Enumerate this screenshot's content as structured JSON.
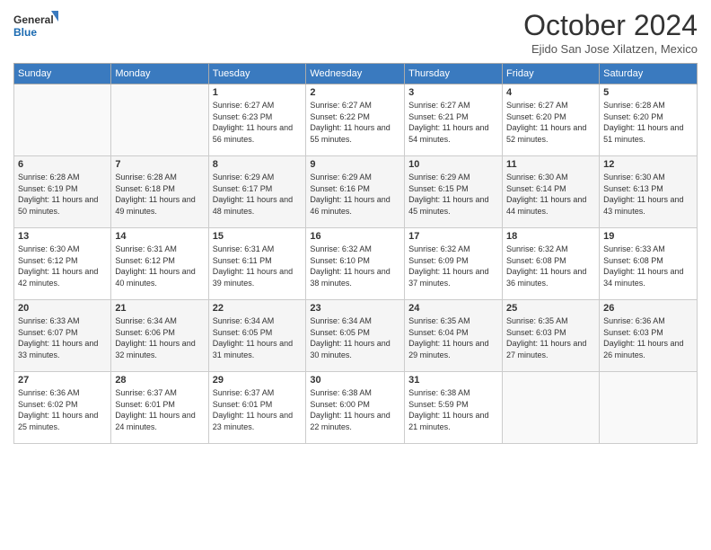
{
  "header": {
    "logo_line1": "General",
    "logo_line2": "Blue",
    "month_title": "October 2024",
    "location": "Ejido San Jose Xilatzen, Mexico"
  },
  "days_of_week": [
    "Sunday",
    "Monday",
    "Tuesday",
    "Wednesday",
    "Thursday",
    "Friday",
    "Saturday"
  ],
  "weeks": [
    [
      {
        "day": "",
        "info": ""
      },
      {
        "day": "",
        "info": ""
      },
      {
        "day": "1",
        "info": "Sunrise: 6:27 AM\nSunset: 6:23 PM\nDaylight: 11 hours and 56 minutes."
      },
      {
        "day": "2",
        "info": "Sunrise: 6:27 AM\nSunset: 6:22 PM\nDaylight: 11 hours and 55 minutes."
      },
      {
        "day": "3",
        "info": "Sunrise: 6:27 AM\nSunset: 6:21 PM\nDaylight: 11 hours and 54 minutes."
      },
      {
        "day": "4",
        "info": "Sunrise: 6:27 AM\nSunset: 6:20 PM\nDaylight: 11 hours and 52 minutes."
      },
      {
        "day": "5",
        "info": "Sunrise: 6:28 AM\nSunset: 6:20 PM\nDaylight: 11 hours and 51 minutes."
      }
    ],
    [
      {
        "day": "6",
        "info": "Sunrise: 6:28 AM\nSunset: 6:19 PM\nDaylight: 11 hours and 50 minutes."
      },
      {
        "day": "7",
        "info": "Sunrise: 6:28 AM\nSunset: 6:18 PM\nDaylight: 11 hours and 49 minutes."
      },
      {
        "day": "8",
        "info": "Sunrise: 6:29 AM\nSunset: 6:17 PM\nDaylight: 11 hours and 48 minutes."
      },
      {
        "day": "9",
        "info": "Sunrise: 6:29 AM\nSunset: 6:16 PM\nDaylight: 11 hours and 46 minutes."
      },
      {
        "day": "10",
        "info": "Sunrise: 6:29 AM\nSunset: 6:15 PM\nDaylight: 11 hours and 45 minutes."
      },
      {
        "day": "11",
        "info": "Sunrise: 6:30 AM\nSunset: 6:14 PM\nDaylight: 11 hours and 44 minutes."
      },
      {
        "day": "12",
        "info": "Sunrise: 6:30 AM\nSunset: 6:13 PM\nDaylight: 11 hours and 43 minutes."
      }
    ],
    [
      {
        "day": "13",
        "info": "Sunrise: 6:30 AM\nSunset: 6:12 PM\nDaylight: 11 hours and 42 minutes."
      },
      {
        "day": "14",
        "info": "Sunrise: 6:31 AM\nSunset: 6:12 PM\nDaylight: 11 hours and 40 minutes."
      },
      {
        "day": "15",
        "info": "Sunrise: 6:31 AM\nSunset: 6:11 PM\nDaylight: 11 hours and 39 minutes."
      },
      {
        "day": "16",
        "info": "Sunrise: 6:32 AM\nSunset: 6:10 PM\nDaylight: 11 hours and 38 minutes."
      },
      {
        "day": "17",
        "info": "Sunrise: 6:32 AM\nSunset: 6:09 PM\nDaylight: 11 hours and 37 minutes."
      },
      {
        "day": "18",
        "info": "Sunrise: 6:32 AM\nSunset: 6:08 PM\nDaylight: 11 hours and 36 minutes."
      },
      {
        "day": "19",
        "info": "Sunrise: 6:33 AM\nSunset: 6:08 PM\nDaylight: 11 hours and 34 minutes."
      }
    ],
    [
      {
        "day": "20",
        "info": "Sunrise: 6:33 AM\nSunset: 6:07 PM\nDaylight: 11 hours and 33 minutes."
      },
      {
        "day": "21",
        "info": "Sunrise: 6:34 AM\nSunset: 6:06 PM\nDaylight: 11 hours and 32 minutes."
      },
      {
        "day": "22",
        "info": "Sunrise: 6:34 AM\nSunset: 6:05 PM\nDaylight: 11 hours and 31 minutes."
      },
      {
        "day": "23",
        "info": "Sunrise: 6:34 AM\nSunset: 6:05 PM\nDaylight: 11 hours and 30 minutes."
      },
      {
        "day": "24",
        "info": "Sunrise: 6:35 AM\nSunset: 6:04 PM\nDaylight: 11 hours and 29 minutes."
      },
      {
        "day": "25",
        "info": "Sunrise: 6:35 AM\nSunset: 6:03 PM\nDaylight: 11 hours and 27 minutes."
      },
      {
        "day": "26",
        "info": "Sunrise: 6:36 AM\nSunset: 6:03 PM\nDaylight: 11 hours and 26 minutes."
      }
    ],
    [
      {
        "day": "27",
        "info": "Sunrise: 6:36 AM\nSunset: 6:02 PM\nDaylight: 11 hours and 25 minutes."
      },
      {
        "day": "28",
        "info": "Sunrise: 6:37 AM\nSunset: 6:01 PM\nDaylight: 11 hours and 24 minutes."
      },
      {
        "day": "29",
        "info": "Sunrise: 6:37 AM\nSunset: 6:01 PM\nDaylight: 11 hours and 23 minutes."
      },
      {
        "day": "30",
        "info": "Sunrise: 6:38 AM\nSunset: 6:00 PM\nDaylight: 11 hours and 22 minutes."
      },
      {
        "day": "31",
        "info": "Sunrise: 6:38 AM\nSunset: 5:59 PM\nDaylight: 11 hours and 21 minutes."
      },
      {
        "day": "",
        "info": ""
      },
      {
        "day": "",
        "info": ""
      }
    ]
  ]
}
